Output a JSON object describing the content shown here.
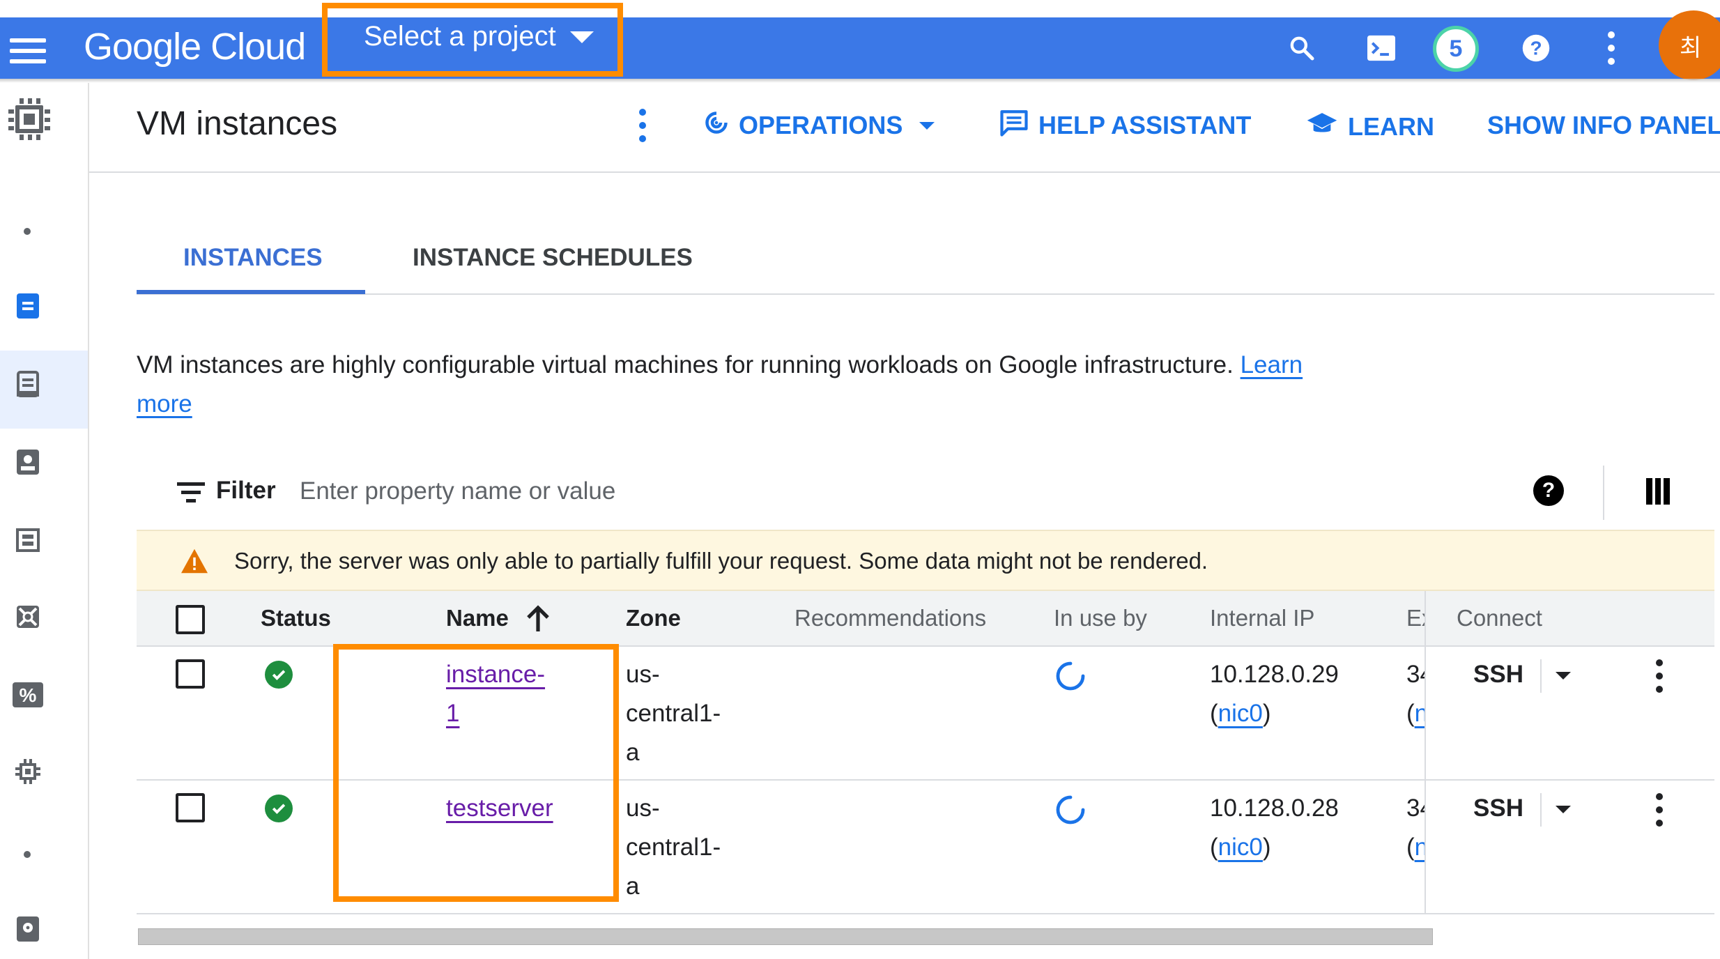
{
  "topbar": {
    "logo": "Google Cloud",
    "project_selector": "Select a project",
    "notifications_count": "5",
    "avatar_initial": "최",
    "icons": [
      "menu-icon",
      "search-icon",
      "cloud-shell-icon",
      "notifications-badge",
      "help-icon",
      "more-vert-icon",
      "account-avatar"
    ]
  },
  "sidebar": {
    "items": [
      "compute-engine-icon",
      "vm-instances-icon",
      "instance-templates-icon",
      "sole-tenant-icon",
      "machine-images-icon",
      "tpus-icon",
      "committed-discounts-icon",
      "migrate-icon",
      "disks-icon"
    ]
  },
  "header": {
    "title": "VM instances",
    "operations": "OPERATIONS",
    "help_assistant": "HELP ASSISTANT",
    "learn": "LEARN",
    "show_info_panel": "SHOW INFO PANEL"
  },
  "tabs": [
    {
      "label": "INSTANCES",
      "active": true
    },
    {
      "label": "INSTANCE SCHEDULES",
      "active": false
    }
  ],
  "description": {
    "text": "VM instances are highly configurable virtual machines for running workloads on Google infrastructure.",
    "link": "Learn more"
  },
  "filter": {
    "label": "Filter",
    "placeholder": "Enter property name or value"
  },
  "warning": {
    "message": "Sorry, the server was only able to partially fulfill your request. Some data might not be rendered."
  },
  "table": {
    "columns": {
      "status": "Status",
      "name": "Name",
      "zone": "Zone",
      "recommendations": "Recommendations",
      "in_use_by": "In use by",
      "internal_ip": "Internal IP",
      "external_ip": "Ex",
      "connect": "Connect"
    },
    "rows": [
      {
        "status": "running",
        "name_line1": "instance-",
        "name_line2": "1",
        "zone_line1": "us-",
        "zone_line2": "central1-",
        "zone_line3": "a",
        "internal_ip": "10.128.0.29",
        "nic_open": "(",
        "nic": "nic0",
        "nic_close": ")",
        "external_ip": "34",
        "external_nic_open": "(",
        "external_nic": "n",
        "connect": "SSH"
      },
      {
        "status": "running",
        "name_line1": "testserver",
        "name_line2": "",
        "zone_line1": "us-",
        "zone_line2": "central1-",
        "zone_line3": "a",
        "internal_ip": "10.128.0.28",
        "nic_open": "(",
        "nic": "nic0",
        "nic_close": ")",
        "external_ip": "34",
        "external_nic_open": "(",
        "external_nic": "n",
        "connect": "SSH"
      }
    ]
  },
  "colors": {
    "topbar": "#3b78e7",
    "accent": "#1a73e8",
    "highlight": "#ff8c00",
    "warning_bg": "#fef7e0",
    "visited_link": "#681da8",
    "status_ok": "#1e8e3e"
  }
}
